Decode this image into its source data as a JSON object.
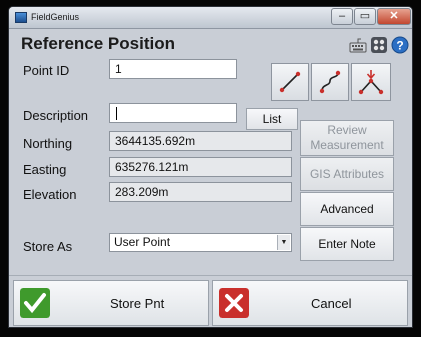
{
  "window": {
    "app_title": "FieldGenius"
  },
  "header": {
    "title": "Reference Position"
  },
  "form": {
    "point_id": {
      "label": "Point ID",
      "value": "1"
    },
    "description": {
      "label": "Description",
      "value": ""
    },
    "northing": {
      "label": "Northing",
      "value": "3644135.692m"
    },
    "easting": {
      "label": "Easting",
      "value": "635276.121m"
    },
    "elevation": {
      "label": "Elevation",
      "value": "283.209m"
    },
    "store_as": {
      "label": "Store As",
      "value": "User Point"
    }
  },
  "buttons": {
    "list": "List",
    "review_measurement": "Review Measurement",
    "gis_attributes": "GIS Attributes",
    "advanced": "Advanced",
    "enter_note": "Enter Note",
    "store_pnt": "Store Pnt",
    "cancel": "Cancel"
  },
  "icons": {
    "line": "line-icon",
    "curve": "curve-icon",
    "point_split": "point-split-icon",
    "keyboard": "keyboard-icon",
    "settings": "settings-icon",
    "help": "help-icon",
    "ok": "checkmark-icon",
    "cancel": "cancel-x-icon"
  },
  "colors": {
    "accent_red": "#c9302c",
    "accent_green": "#3f9a2c",
    "help_blue": "#2b6fc4"
  }
}
